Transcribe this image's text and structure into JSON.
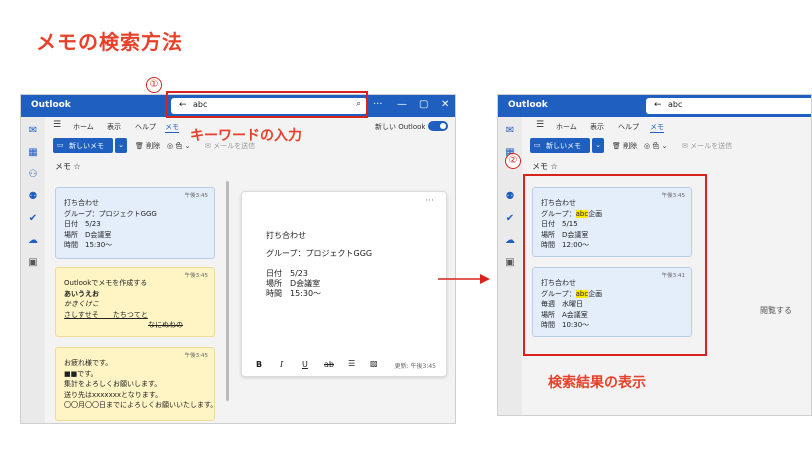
{
  "page_title": "メモの検索方法",
  "colors": {
    "accent": "#1f5fbf",
    "annotation_red": "#e8402a",
    "highlight": "#ffe500"
  },
  "left": {
    "app_name": "Outlook",
    "search": {
      "query": "abc"
    },
    "step": "①",
    "annotation": "キーワードの入力",
    "menu": [
      "ホーム",
      "表示",
      "ヘルプ",
      "メモ"
    ],
    "new_outlook_label": "新しい Outlook",
    "toolbar": {
      "new_note": "新しいメモ",
      "delete": "削除",
      "color": "色",
      "email": "メールを送信"
    },
    "list_title": "メモ",
    "notes": [
      {
        "time": "午後3:45",
        "lines": [
          "打ち合わせ",
          "グループ：プロジェクトGGG",
          "日付　5/23",
          "場所　D会議室",
          "時間　15:30～"
        ]
      },
      {
        "time": "午後3:45",
        "lines": [
          "Outlookでメモを作成する",
          "あいうえお",
          "かきくけこ",
          "さしすせそ　　たちつてと",
          "なにぬねの"
        ]
      },
      {
        "time": "午後3:45",
        "lines": [
          "お疲れ様です。",
          "■■です。",
          "集計をよろしくお願いします。",
          "送り先はxxxxxxxとなります。",
          "〇〇月〇〇日までによろしくお願いいたします。"
        ]
      }
    ],
    "detail": {
      "lines": [
        "打ち合わせ",
        "グループ：プロジェクトGGG",
        "日付　5/23",
        "場所　D会議室",
        "時間　15:30～"
      ],
      "format_bold": "B",
      "format_italic": "I",
      "format_underline": "U",
      "format_strike": "ab",
      "updated": "更新: 午後3:45"
    }
  },
  "right": {
    "app_name": "Outlook",
    "search": {
      "query": "abc"
    },
    "step": "②",
    "annotation": "検索結果の表示",
    "menu": [
      "ホーム",
      "表示",
      "ヘルプ",
      "メモ"
    ],
    "toolbar": {
      "new_note": "新しいメモ",
      "delete": "削除",
      "color": "色",
      "email": "メールを送信"
    },
    "list_title": "メモ",
    "results": [
      {
        "time": "午後3:45",
        "title": "打ち合わせ",
        "group_prefix": "グループ：",
        "match": "abc",
        "group_suffix": "企画",
        "lines": [
          "日付　5/15",
          "場所　D会議室",
          "時間　12:00～"
        ]
      },
      {
        "time": "午後3:41",
        "title": "打ち合わせ",
        "group_prefix": "グループ：",
        "match": "abc",
        "group_suffix": "企画",
        "lines": [
          "毎週　水曜日",
          "場所　A会議室",
          "時間　10:30～"
        ]
      }
    ],
    "reading_pane": "閲覧する"
  }
}
